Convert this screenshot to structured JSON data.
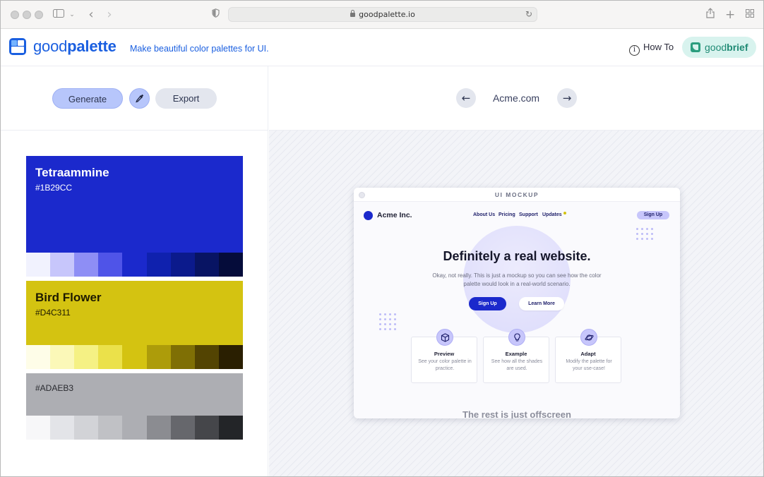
{
  "browser": {
    "url": "goodpalette.io"
  },
  "header": {
    "logo_light": "good",
    "logo_bold": "palette",
    "tagline": "Make beautiful color palettes for UI.",
    "howto_label": "How To",
    "goodbrief_light": "good",
    "goodbrief_bold": "brief"
  },
  "toolbar": {
    "generate_label": "Generate",
    "export_label": "Export"
  },
  "palette": [
    {
      "name": "Tetraammine",
      "hex": "#1B29CC",
      "color": "#1b29cc",
      "text_color": "#ffffff",
      "shades": [
        "#f1f2fe",
        "#c7c6fb",
        "#8e8ef5",
        "#4f54e8",
        "#1b29cc",
        "#0f21ae",
        "#0b1a8c",
        "#081463",
        "#050c3a"
      ]
    },
    {
      "name": "Bird Flower",
      "hex": "#D4C311",
      "color": "#d4c311",
      "text_color": "#1e1a00",
      "shades": [
        "#fefde8",
        "#fbf8b8",
        "#f5f184",
        "#ebe14a",
        "#d4c311",
        "#ad9c0a",
        "#7f6f05",
        "#534402",
        "#2a1f01"
      ]
    },
    {
      "name": "",
      "hex": "#ADAEB3",
      "color": "#adaeb3",
      "text_color": "#2a2b30",
      "shades": [
        "#f7f7f9",
        "#e3e4e8",
        "#d2d3d7",
        "#c0c1c5",
        "#adaeb3",
        "#8b8c91",
        "#66676c",
        "#45464a",
        "#232528"
      ]
    }
  ],
  "preview": {
    "site_name": "Acme.com",
    "mock_title": "UI MOCKUP",
    "brand": "Acme Inc.",
    "nav": [
      "About Us",
      "Pricing",
      "Support",
      "Updates"
    ],
    "signup_top": "Sign Up",
    "headline": "Definitely a real website.",
    "paragraph": "Okay, not really. This is just a mockup so you can see how the color palette would look in a real-world scenario.",
    "primary_cta": "Sign Up",
    "secondary_cta": "Learn More",
    "cards": [
      {
        "icon": "cube-icon",
        "title": "Preview",
        "desc": "See your color palette in practice."
      },
      {
        "icon": "lightbulb-icon",
        "title": "Example",
        "desc": "See how all the shades are used."
      },
      {
        "icon": "planet-icon",
        "title": "Adapt",
        "desc": "Modify the palette for your use-case!"
      }
    ],
    "bottom_text": "The rest is just offscreen"
  }
}
